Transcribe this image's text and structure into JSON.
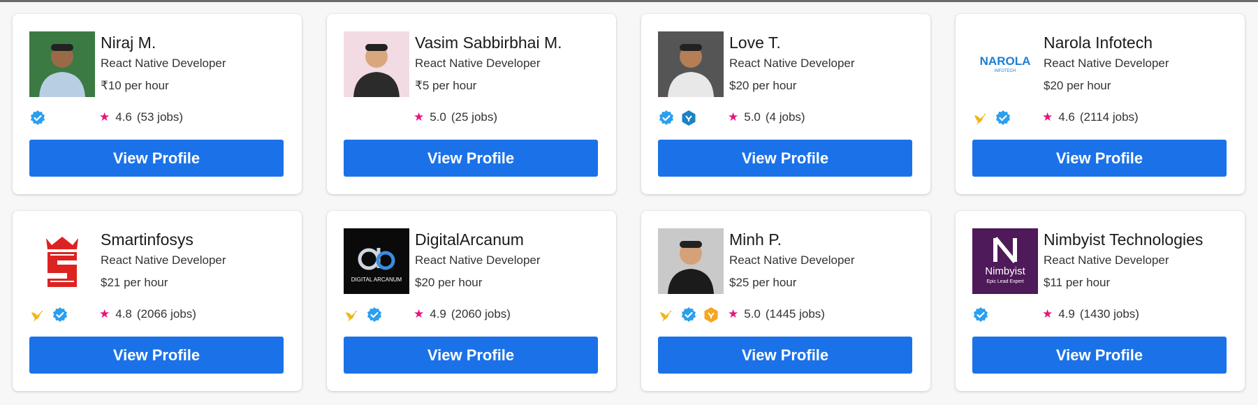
{
  "button_label": "View Profile",
  "colors": {
    "accent": "#1b72e8",
    "star": "#e8137b",
    "verified": "#2a9ff0",
    "pro_badge": "#1d82c5",
    "gold_badge": "#f5a623"
  },
  "cards": [
    {
      "name": "Niraj M.",
      "role": "React Native Developer",
      "rate": "₹10 per hour",
      "rating": "4.6",
      "jobs": "(53 jobs)",
      "avatar": "person-photo-icon",
      "badges": [
        "verified-icon"
      ]
    },
    {
      "name": "Vasim Sabbirbhai M.",
      "role": "React Native Developer",
      "rate": "₹5 per hour",
      "rating": "5.0",
      "jobs": "(25 jobs)",
      "avatar": "person-photo-icon",
      "badges": []
    },
    {
      "name": "Love T.",
      "role": "React Native Developer",
      "rate": "$20 per hour",
      "rating": "5.0",
      "jobs": "(4 jobs)",
      "avatar": "person-photo-icon",
      "badges": [
        "verified-icon",
        "pro-badge-icon"
      ]
    },
    {
      "name": "Narola Infotech",
      "role": "React Native Developer",
      "rate": "$20 per hour",
      "rating": "4.6",
      "jobs": "(2114 jobs)",
      "avatar": "narola-logo",
      "logo_text": "NAROLA",
      "logo_sub": "INFOTECH",
      "badges": [
        "hummingbird-icon",
        "verified-icon"
      ]
    },
    {
      "name": "Smartinfosys",
      "role": "React Native Developer",
      "rate": "$21 per hour",
      "rating": "4.8",
      "jobs": "(2066 jobs)",
      "avatar": "smartinfosys-logo",
      "badges": [
        "hummingbird-icon",
        "verified-icon"
      ]
    },
    {
      "name": "DigitalArcanum",
      "role": "React Native Developer",
      "rate": "$20 per hour",
      "rating": "4.9",
      "jobs": "(2060 jobs)",
      "avatar": "digitalarcanum-logo",
      "logo_text": "DIGITAL ARCANUM",
      "badges": [
        "hummingbird-icon",
        "verified-icon"
      ]
    },
    {
      "name": "Minh P.",
      "role": "React Native Developer",
      "rate": "$25 per hour",
      "rating": "5.0",
      "jobs": "(1445 jobs)",
      "avatar": "person-photo-icon",
      "badges": [
        "hummingbird-icon",
        "verified-icon",
        "gold-badge-icon"
      ]
    },
    {
      "name": "Nimbyist Technologies",
      "role": "React Native Developer",
      "rate": "$11 per hour",
      "rating": "4.9",
      "jobs": "(1430 jobs)",
      "avatar": "nimbyist-logo",
      "logo_text": "Nimbyist",
      "logo_sub": "Epic Lead Expert",
      "badges": [
        "verified-icon"
      ]
    }
  ]
}
